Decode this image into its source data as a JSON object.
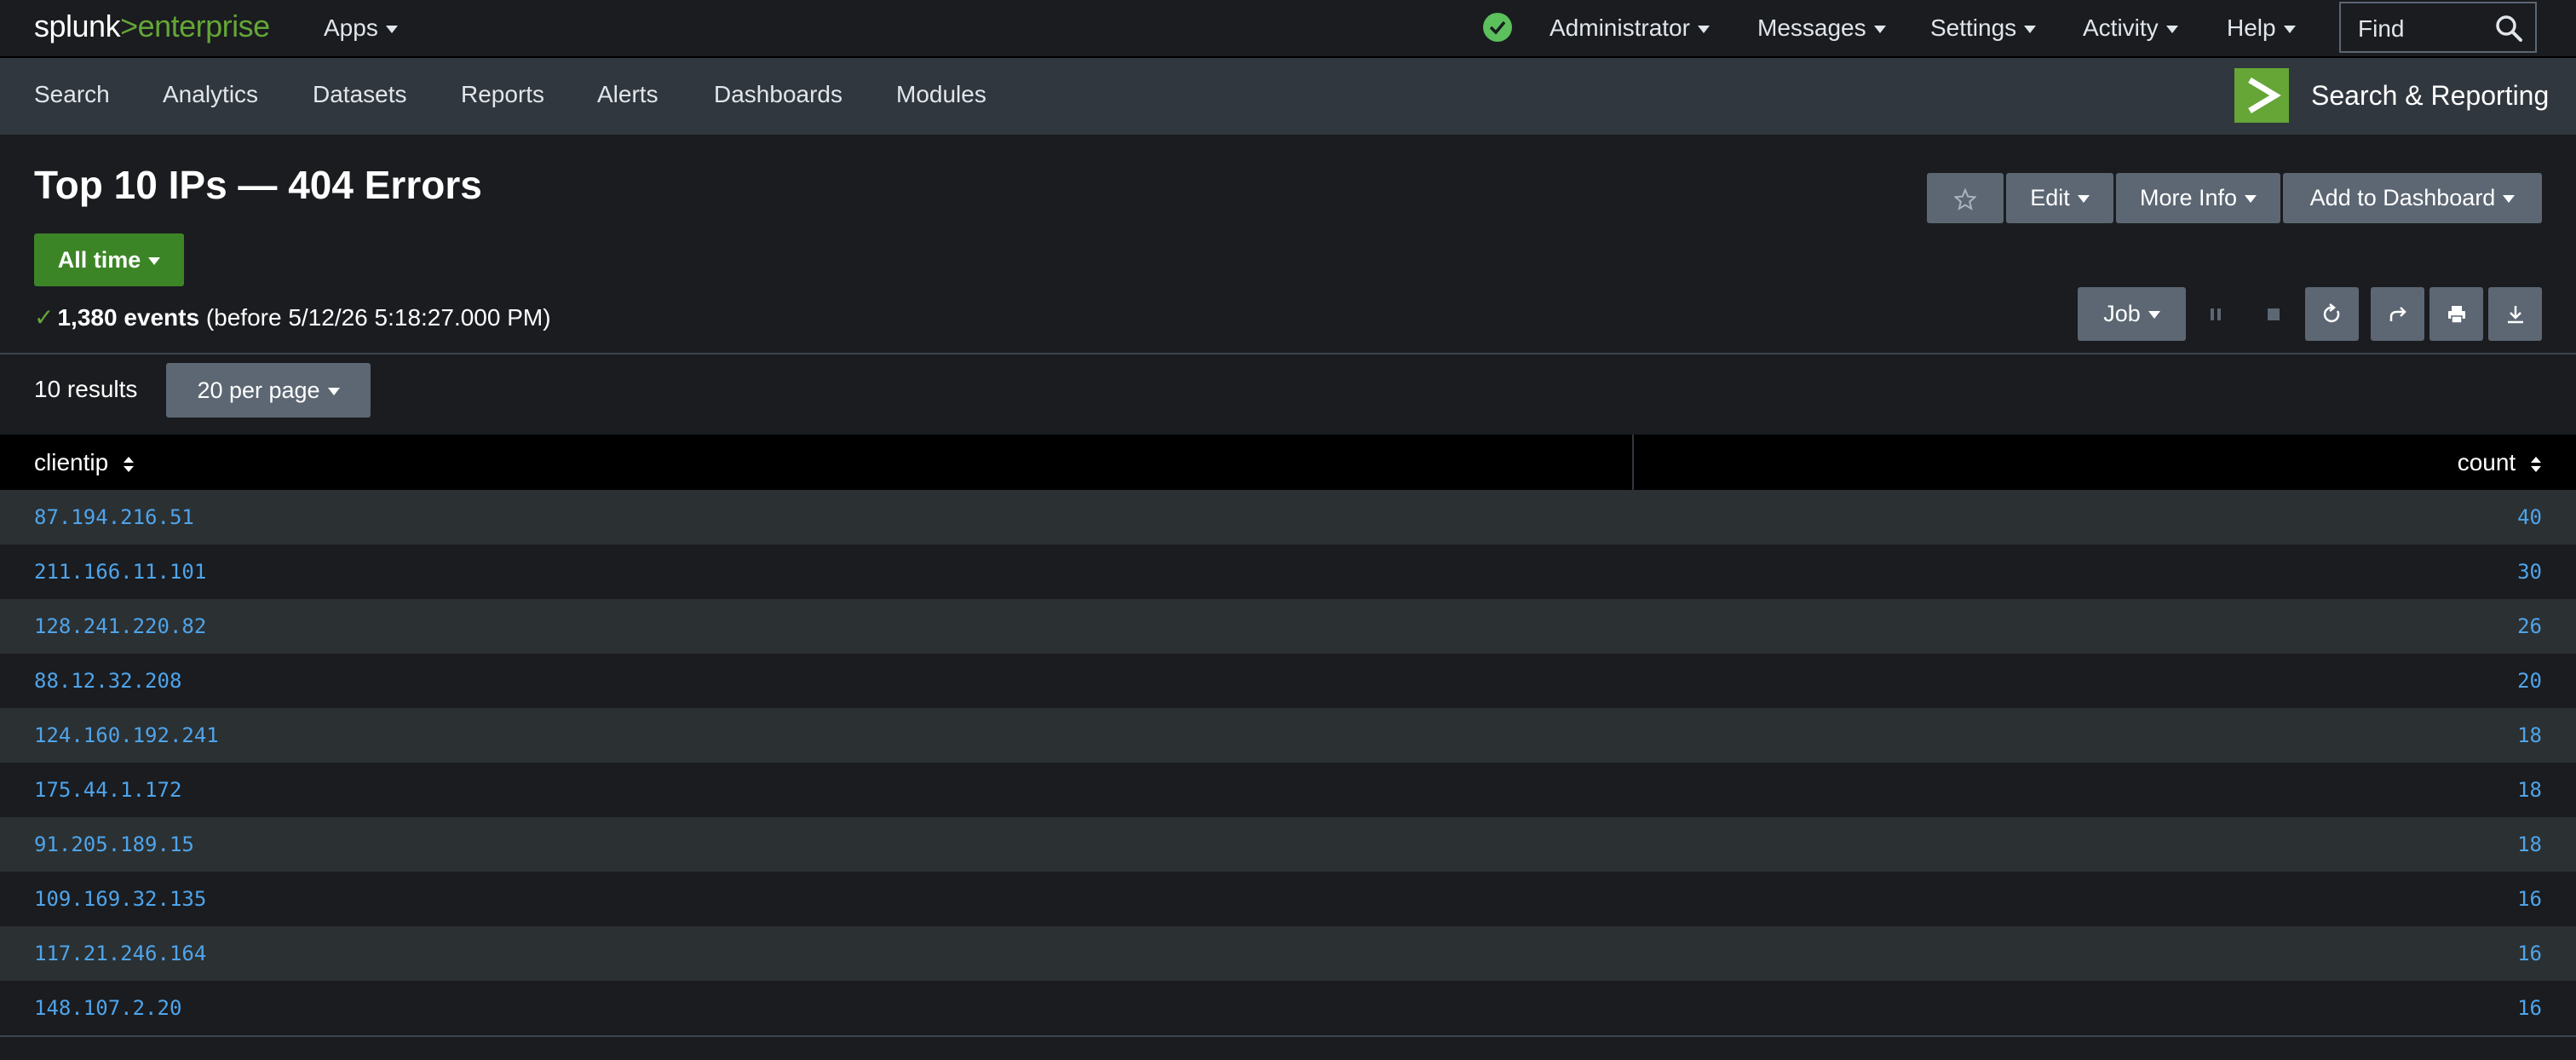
{
  "topbar": {
    "logo_prefix": "splunk",
    "logo_gt": ">",
    "logo_suffix": "enterprise",
    "apps": "Apps",
    "user": "Administrator",
    "messages": "Messages",
    "settings": "Settings",
    "activity": "Activity",
    "help": "Help",
    "find_placeholder": "Find"
  },
  "appnav": {
    "items": [
      "Search",
      "Analytics",
      "Datasets",
      "Reports",
      "Alerts",
      "Dashboards",
      "Modules"
    ],
    "app_title": "Search & Reporting"
  },
  "page": {
    "title": "Top 10 IPs — 404 Errors",
    "time_range": "All time",
    "edit": "Edit",
    "more_info": "More Info",
    "add_to_dashboard": "Add to Dashboard",
    "events_count": "1,380 events",
    "events_suffix": "(before 5/12/26 5:18:27.000 PM)",
    "job": "Job"
  },
  "results": {
    "count_label": "10 results",
    "per_page": "20 per page",
    "columns": [
      "clientip",
      "count"
    ],
    "rows": [
      {
        "clientip": "87.194.216.51",
        "count": "40"
      },
      {
        "clientip": "211.166.11.101",
        "count": "30"
      },
      {
        "clientip": "128.241.220.82",
        "count": "26"
      },
      {
        "clientip": "88.12.32.208",
        "count": "20"
      },
      {
        "clientip": "124.160.192.241",
        "count": "18"
      },
      {
        "clientip": "175.44.1.172",
        "count": "18"
      },
      {
        "clientip": "91.205.189.15",
        "count": "18"
      },
      {
        "clientip": "109.169.32.135",
        "count": "16"
      },
      {
        "clientip": "117.21.246.164",
        "count": "16"
      },
      {
        "clientip": "148.107.2.20",
        "count": "16"
      }
    ]
  },
  "colors": {
    "accent_green": "#65a637",
    "link_blue": "#4fa4ea",
    "button_gray": "#5c6773"
  }
}
